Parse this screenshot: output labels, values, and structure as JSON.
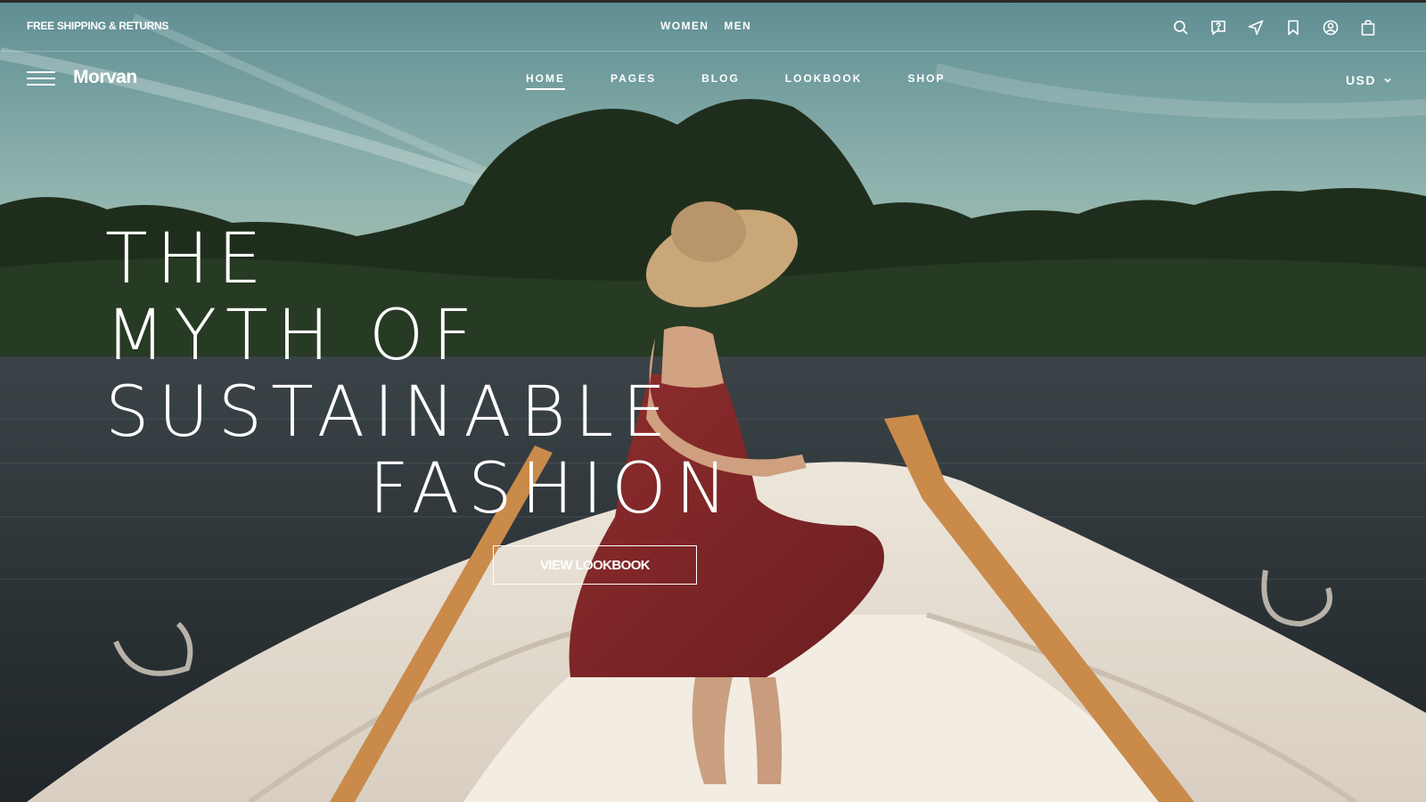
{
  "topbar": {
    "promo": "FREE SHIPPING & RETURNS",
    "gender_nav": [
      "WOMEN",
      "MEN"
    ],
    "icons": [
      "search-icon",
      "help-icon",
      "location-icon",
      "bookmark-icon",
      "account-icon",
      "bag-icon"
    ]
  },
  "nav": {
    "brand": "Morvan",
    "items": [
      {
        "label": "HOME",
        "active": true
      },
      {
        "label": "PAGES",
        "active": false
      },
      {
        "label": "BLOG",
        "active": false
      },
      {
        "label": "LOOKBOOK",
        "active": false
      },
      {
        "label": "SHOP",
        "active": false
      }
    ],
    "currency": "USD"
  },
  "hero": {
    "headline": [
      "THE",
      "MYTH OF",
      "SUSTAINABLE",
      "FASHION"
    ],
    "cta": "VIEW LOOKBOOK"
  },
  "colors": {
    "text": "#ffffff",
    "sky": "#7ea6a8",
    "water": "#2c3338",
    "dress": "#8a2a2a",
    "boat": "#e8dfd2",
    "oar": "#c98a4a"
  }
}
